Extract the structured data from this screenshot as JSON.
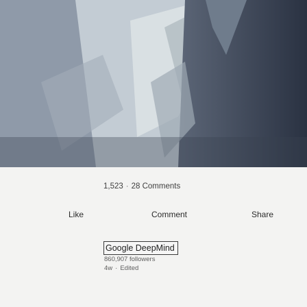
{
  "post": {
    "reactions_count": "1,523",
    "comments_count": "28 Comments"
  },
  "actions": {
    "like_label": "Like",
    "comment_label": "Comment",
    "share_label": "Share"
  },
  "author": {
    "name": "Google DeepMind",
    "followers": "860,907 followers",
    "age": "4w",
    "edited": "Edited"
  },
  "colors": {
    "background": "#f3f3f2",
    "image_dark": "#2c3546",
    "text": "#2b2b2b"
  }
}
